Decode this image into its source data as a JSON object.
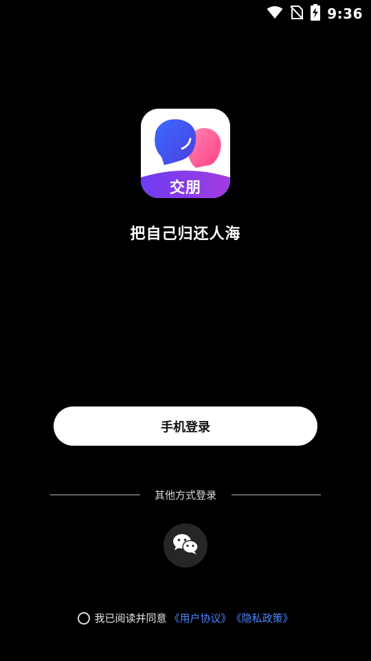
{
  "status_bar": {
    "time": "9:36",
    "icons": [
      "wifi-icon",
      "no-sim-icon",
      "battery-charging-icon"
    ]
  },
  "app": {
    "logo_text": "交朋",
    "slogan": "把自己归还人海"
  },
  "login": {
    "phone_login_label": "手机登录",
    "other_methods_label": "其他方式登录",
    "wechat_icon": "wechat-icon"
  },
  "agreement": {
    "prefix": "我已阅读并同意",
    "user_agreement": "《用户协议》",
    "privacy_policy": "《隐私政策》"
  },
  "colors": {
    "background": "#000000",
    "link": "#4e86ff",
    "logo_blue": "#3f5cf0",
    "logo_pink": "#ff5d9a",
    "logo_band": "#7c3aed"
  }
}
